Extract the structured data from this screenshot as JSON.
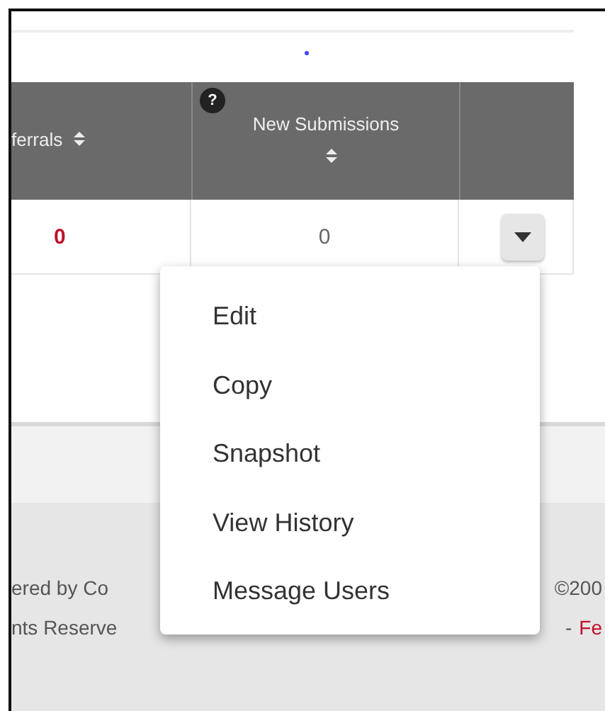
{
  "table": {
    "columns": [
      {
        "label": "ferrals",
        "sortable": true
      },
      {
        "label": "New Submissions",
        "sortable": true,
        "help": "?"
      }
    ],
    "rows": [
      {
        "cells": [
          {
            "text": "0",
            "kind": "alert"
          },
          {
            "text": "0",
            "kind": "plain"
          },
          {
            "kind": "menu"
          }
        ]
      }
    ]
  },
  "menu": {
    "items": [
      {
        "label": "Edit"
      },
      {
        "label": "Copy"
      },
      {
        "label": "Snapshot"
      },
      {
        "label": "View History"
      },
      {
        "label": "Message Users"
      }
    ]
  },
  "footer": {
    "lines": [
      {
        "left": "ered by Co",
        "right": [
          {
            "text": "©200",
            "kind": "text"
          }
        ]
      },
      {
        "left": "nts Reserve",
        "right": [
          {
            "text": "-",
            "kind": "text"
          },
          {
            "text": "Fe",
            "kind": "link"
          }
        ]
      }
    ]
  }
}
